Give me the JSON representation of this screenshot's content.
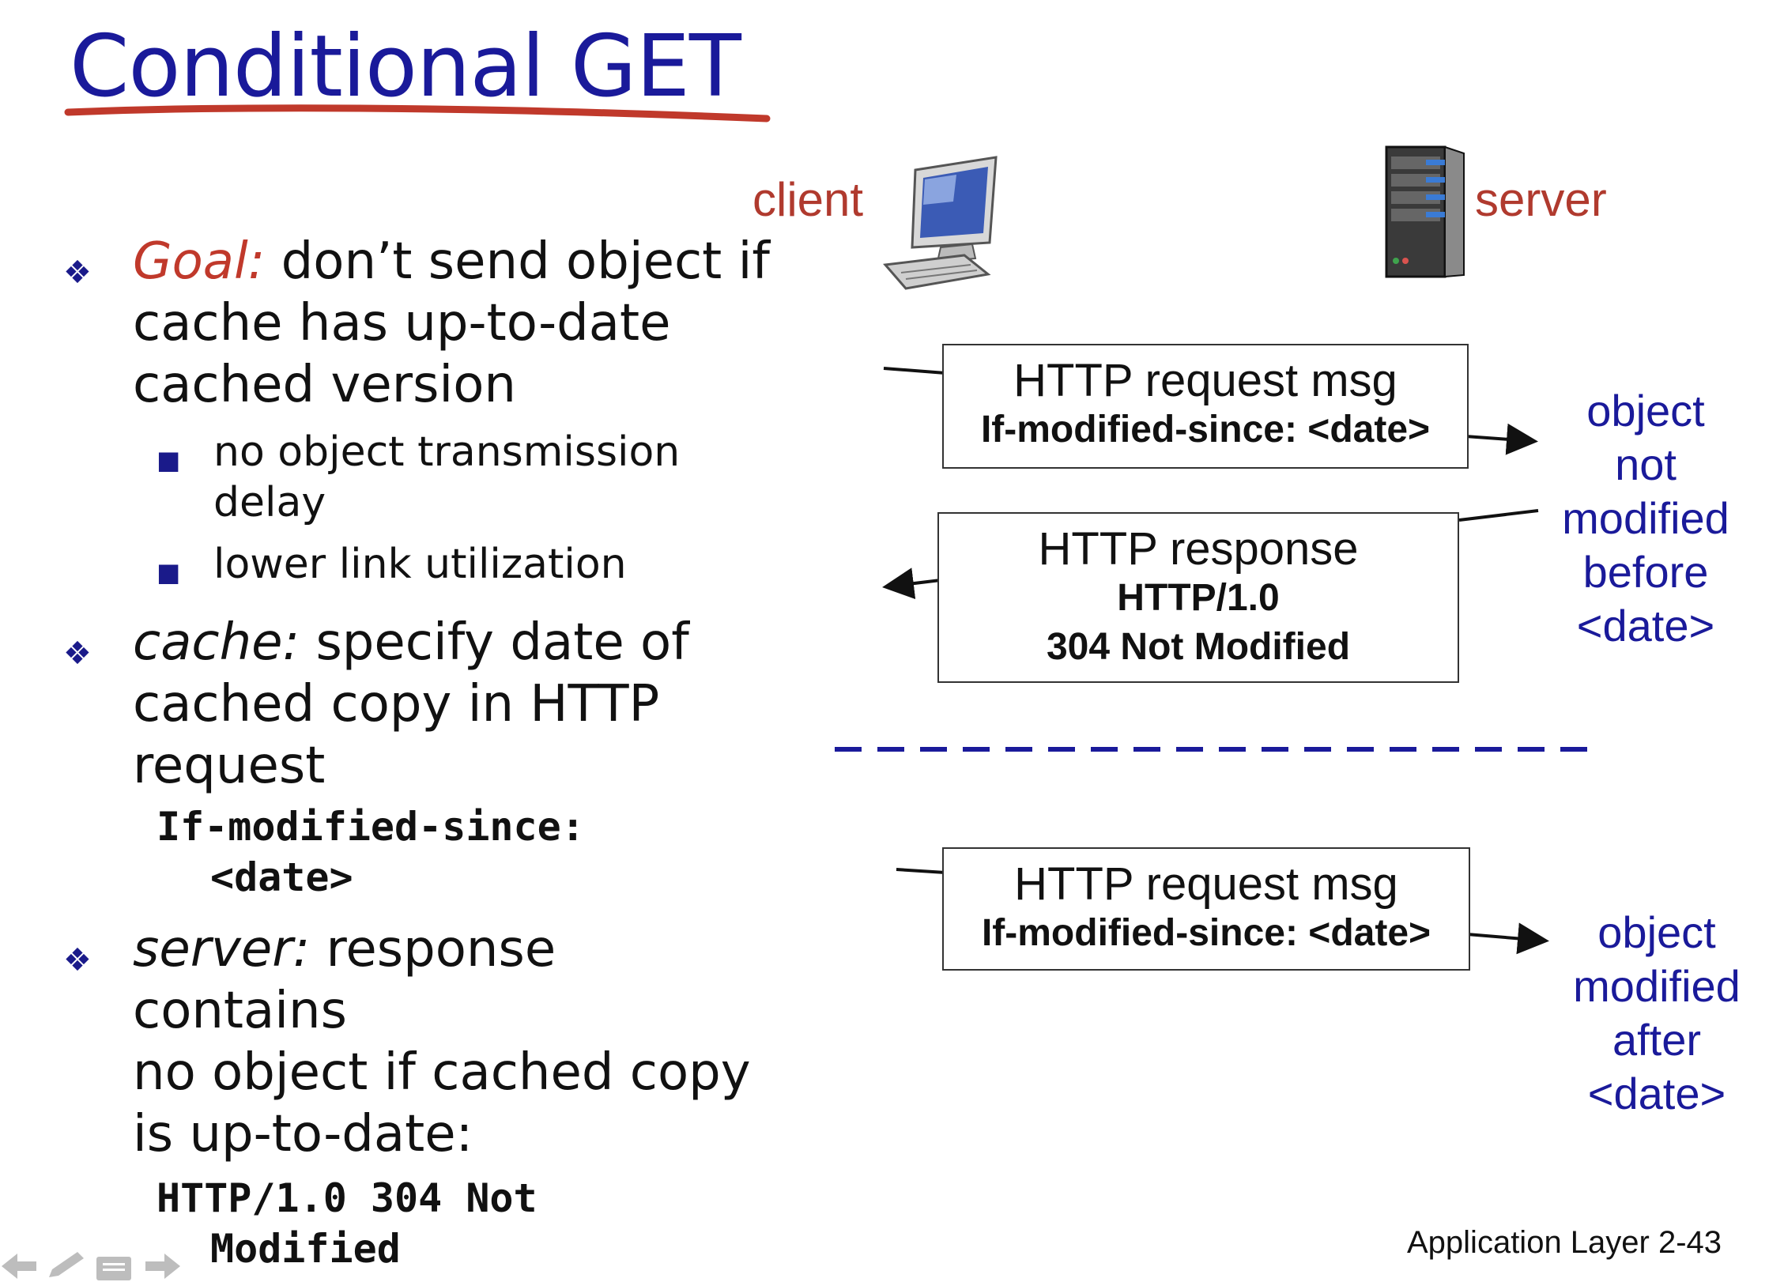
{
  "slide": {
    "title": "Conditional GET",
    "footer": "Application Layer 2-43"
  },
  "bullets": {
    "goal_label": "Goal:",
    "goal_text_1": " don’t send object if",
    "goal_text_2": "cache has up-to-date",
    "goal_text_3": "cached version",
    "sub1_line1": "no object transmission",
    "sub1_line2": "delay",
    "sub2": "lower link utilization",
    "cache_label": "cache:",
    "cache_text_1": " specify date of",
    "cache_text_2": "cached copy in HTTP",
    "cache_text_3": "request",
    "cache_code_1": "If-modified-since:",
    "cache_code_2": "<date>",
    "server_label": "server:",
    "server_text_1": " response contains",
    "server_text_2": "no object if cached copy",
    "server_text_3": "is up-to-date:",
    "server_code_1": "HTTP/1.0 304 Not",
    "server_code_2": "Modified"
  },
  "diagram": {
    "client_label": "client",
    "server_label": "server",
    "box1": {
      "line1": "HTTP request msg",
      "line2": "If-modified-since: <date>"
    },
    "box2": {
      "line1": "HTTP response",
      "line2": "HTTP/1.0",
      "line3": "304 Not Modified"
    },
    "box3": {
      "line1": "HTTP request msg",
      "line2": "If-modified-since: <date>"
    },
    "side1": [
      "object",
      "not",
      "modified",
      "before",
      "<date>"
    ],
    "side2": [
      "object",
      "modified",
      "after",
      "<date>"
    ]
  },
  "colors": {
    "title": "#1a1a9a",
    "underline": "#c0392b",
    "label_red": "#b03a2e",
    "side_blue": "#1a1a9a",
    "dash_blue": "#1a1a9a"
  },
  "icons": {
    "client": "computer-icon",
    "server": "server-tower-icon",
    "nav": [
      "back-arrow-icon",
      "pen-icon",
      "menu-icon",
      "forward-arrow-icon"
    ]
  }
}
